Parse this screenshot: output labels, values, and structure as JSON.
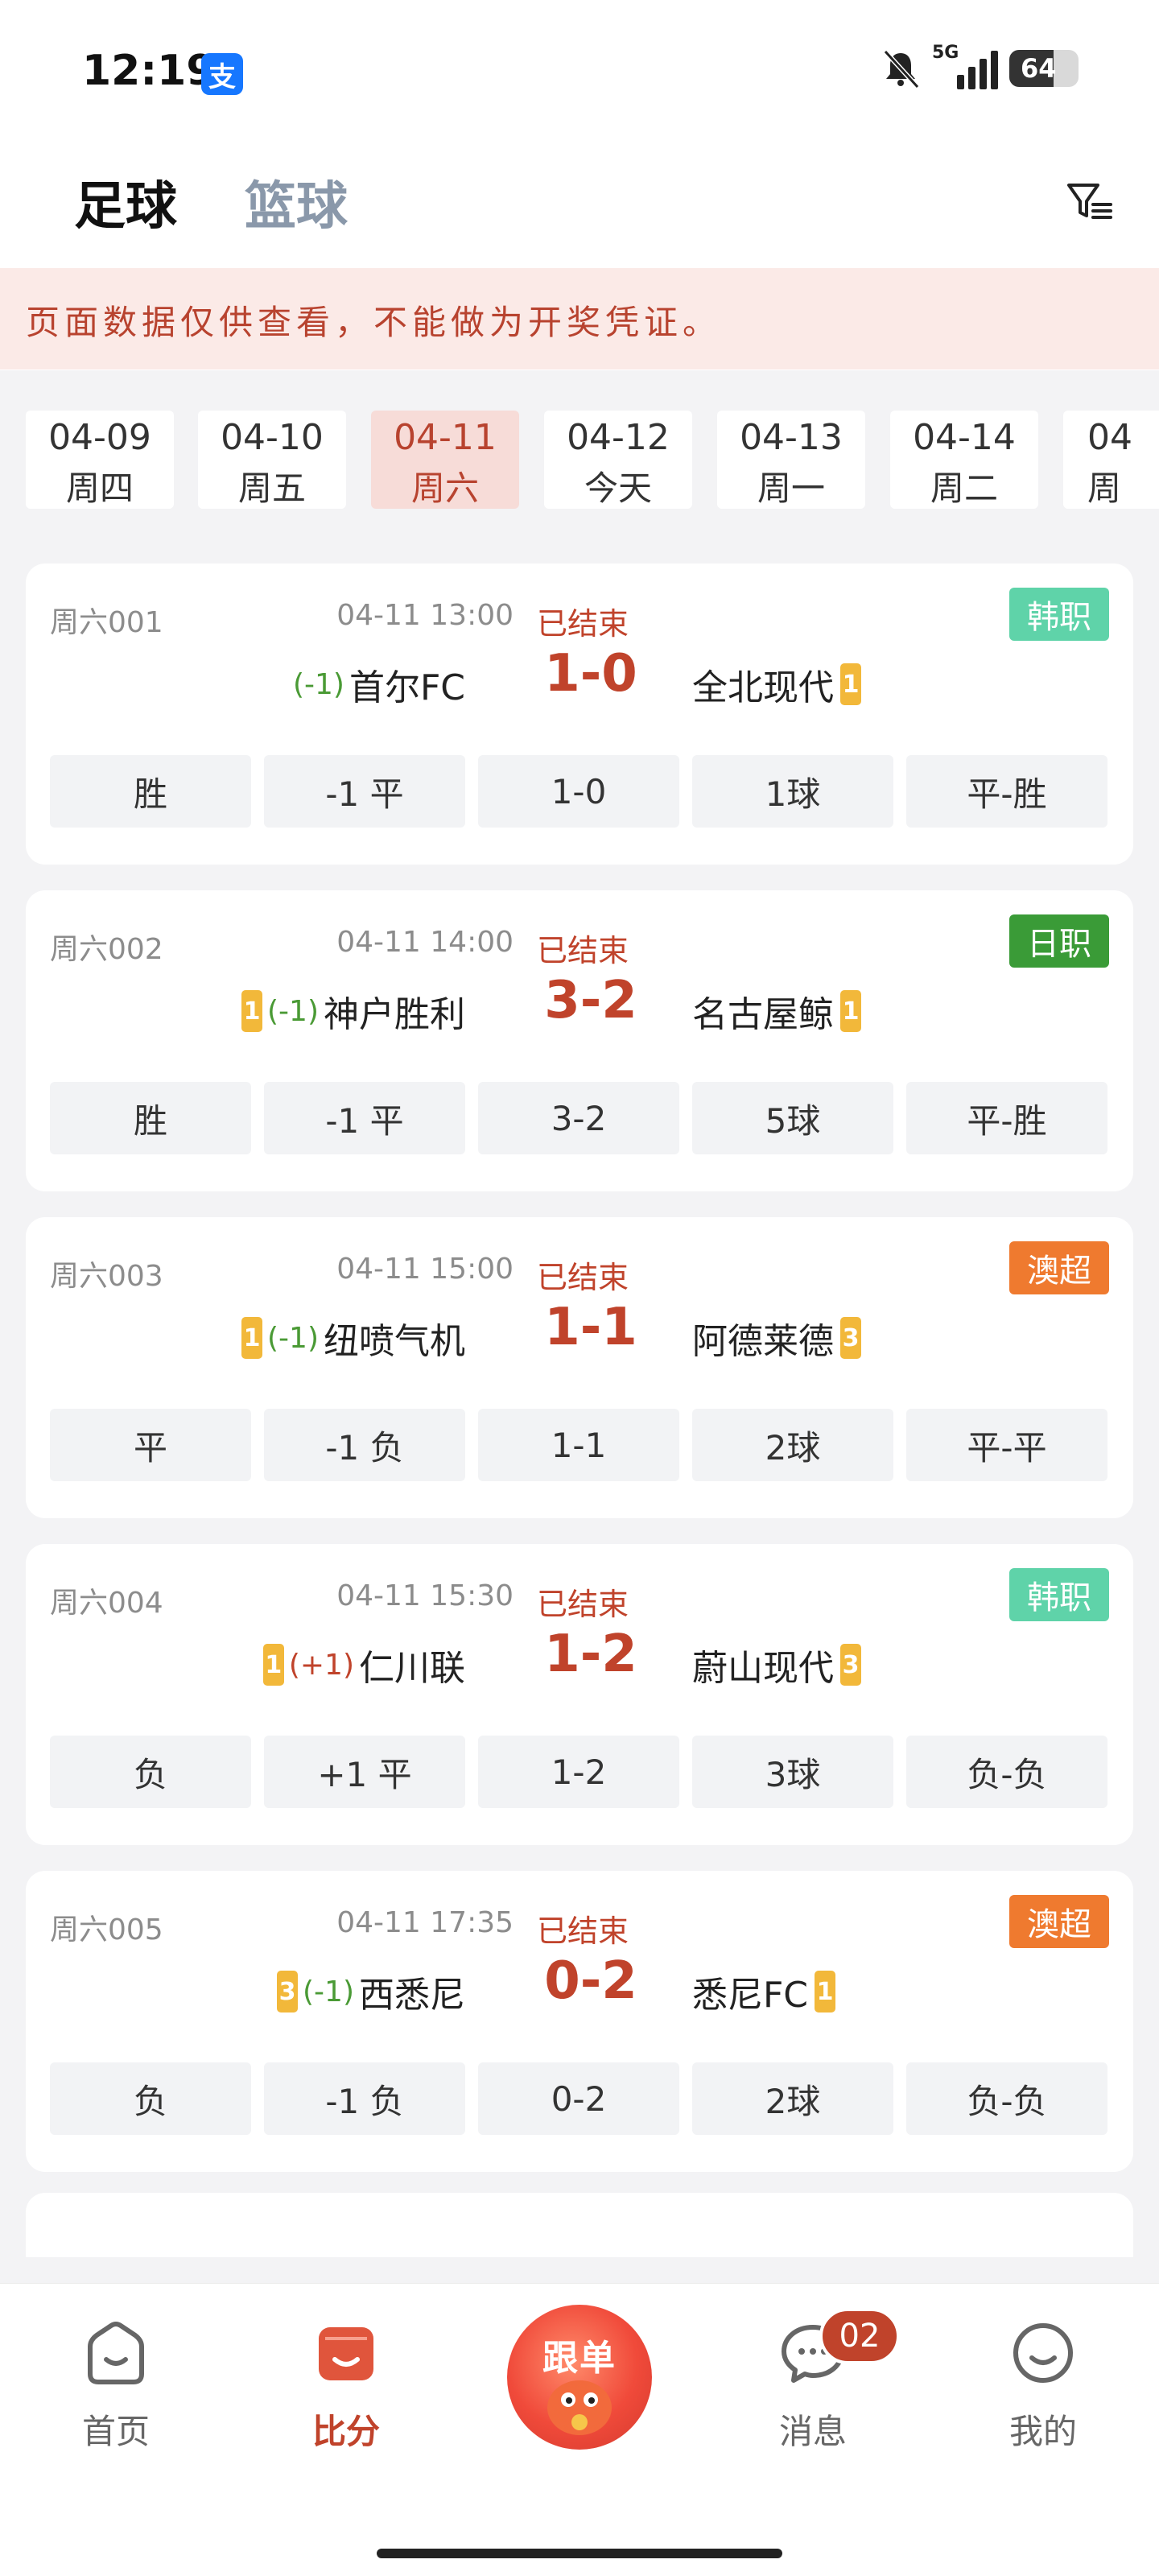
{
  "status_bar": {
    "time": "12:19",
    "alipay_icon": "支",
    "network": "5G",
    "battery": "64",
    "battery_level": 0.64
  },
  "sport_tabs": [
    {
      "label": "足球",
      "active": true
    },
    {
      "label": "篮球",
      "active": false
    }
  ],
  "notice": "页面数据仅供查看，不能做为开奖凭证。",
  "dates": [
    {
      "date": "04-09",
      "weekday": "周四",
      "active": false
    },
    {
      "date": "04-10",
      "weekday": "周五",
      "active": false
    },
    {
      "date": "04-11",
      "weekday": "周六",
      "active": true
    },
    {
      "date": "04-12",
      "weekday": "今天",
      "active": false
    },
    {
      "date": "04-13",
      "weekday": "周一",
      "active": false
    },
    {
      "date": "04-14",
      "weekday": "周二",
      "active": false
    },
    {
      "date": "04",
      "weekday": "周",
      "active": false
    }
  ],
  "matches": [
    {
      "code": "周六001",
      "time": "04-11 13:00",
      "status": "已结束",
      "league": "韩职",
      "league_color": "#5fd3a9",
      "home_rank": "",
      "handicap": "(-1)",
      "home": "首尔FC",
      "score": "1-0",
      "away": "全北现代",
      "away_rank": "1",
      "results": [
        "胜",
        "-1 平",
        "1-0",
        "1球",
        "平-胜"
      ]
    },
    {
      "code": "周六002",
      "time": "04-11 14:00",
      "status": "已结束",
      "league": "日职",
      "league_color": "#3a9b37",
      "home_rank": "1",
      "handicap": "(-1)",
      "home": "神户胜利",
      "score": "3-2",
      "away": "名古屋鲸",
      "away_rank": "1",
      "results": [
        "胜",
        "-1 平",
        "3-2",
        "5球",
        "平-胜"
      ]
    },
    {
      "code": "周六003",
      "time": "04-11 15:00",
      "status": "已结束",
      "league": "澳超",
      "league_color": "#ef7a2f",
      "home_rank": "1",
      "handicap": "(-1)",
      "home": "纽喷气机",
      "score": "1-1",
      "away": "阿德莱德",
      "away_rank": "3",
      "results": [
        "平",
        "-1 负",
        "1-1",
        "2球",
        "平-平"
      ]
    },
    {
      "code": "周六004",
      "time": "04-11 15:30",
      "status": "已结束",
      "league": "韩职",
      "league_color": "#5fd3a9",
      "home_rank": "1",
      "handicap": "(+1)",
      "home": "仁川联",
      "score": "1-2",
      "away": "蔚山现代",
      "away_rank": "3",
      "results": [
        "负",
        "+1 平",
        "1-2",
        "3球",
        "负-负"
      ]
    },
    {
      "code": "周六005",
      "time": "04-11 17:35",
      "status": "已结束",
      "league": "澳超",
      "league_color": "#ef7a2f",
      "home_rank": "3",
      "handicap": "(-1)",
      "home": "西悉尼",
      "score": "0-2",
      "away": "悉尼FC",
      "away_rank": "1",
      "results": [
        "负",
        "-1 负",
        "0-2",
        "2球",
        "负-负"
      ]
    }
  ],
  "bottom_nav": {
    "home": "首页",
    "score": "比分",
    "follow": "跟单",
    "messages": "消息",
    "messages_badge": "02",
    "mine": "我的"
  },
  "colors": {
    "accent": "#c0432b",
    "notice_bg": "#fbeae7",
    "handicap_negative": "#4a9a35",
    "rank_badge": "#f2b83a"
  }
}
